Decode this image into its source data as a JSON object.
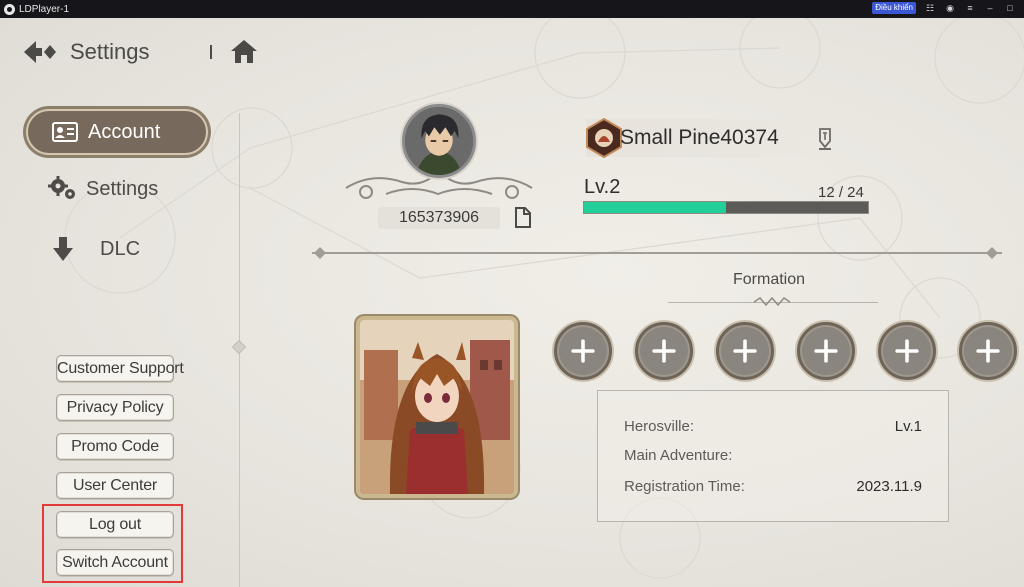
{
  "window": {
    "title": "LDPlayer-1",
    "control_button": "Điều khiển",
    "icons": [
      "gamepad-icon",
      "account-icon",
      "menu-icon",
      "minimize-icon",
      "maximize-icon"
    ]
  },
  "header": {
    "title": "Settings"
  },
  "sidebar": {
    "items": [
      {
        "label": "Account",
        "icon": "account-card-icon",
        "active": true
      },
      {
        "label": "Settings",
        "icon": "gears-icon",
        "active": false
      },
      {
        "label": "DLC",
        "icon": "download-arrow-icon",
        "active": false
      }
    ],
    "buttons": [
      {
        "label": "Customer Support"
      },
      {
        "label": "Privacy Policy"
      },
      {
        "label": "Promo Code"
      },
      {
        "label": "User Center"
      },
      {
        "label": "Log out"
      },
      {
        "label": "Switch Account"
      }
    ]
  },
  "profile": {
    "uid": "165373906",
    "name": "Small Pine40374",
    "level": "Lv.2",
    "exp_text": "12 / 24",
    "exp_current": 12,
    "exp_max": 24
  },
  "formation": {
    "title": "Formation",
    "empty_slots": 6
  },
  "info": {
    "rows": [
      {
        "label": "Herosville:",
        "value": "Lv.1"
      },
      {
        "label": "Main Adventure:",
        "value": ""
      },
      {
        "label": "Registration Time:",
        "value": "2023.11.9"
      }
    ]
  },
  "colors": {
    "exp_fill": "#22cf98",
    "highlight_box": "#e23a3a",
    "active_nav": "#776a5c"
  }
}
